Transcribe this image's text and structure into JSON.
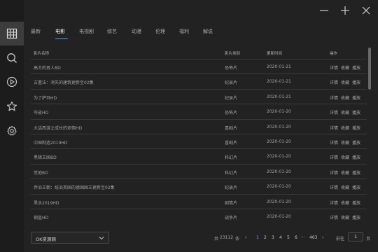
{
  "window": {
    "controls": [
      "minimize",
      "maximize",
      "close"
    ]
  },
  "sidebar": {
    "items": [
      {
        "icon": "film-grid-icon",
        "active": true
      },
      {
        "icon": "search-icon",
        "active": false
      },
      {
        "icon": "play-circle-icon",
        "active": false
      },
      {
        "icon": "star-icon",
        "active": false
      },
      {
        "icon": "gear-icon",
        "active": false
      }
    ]
  },
  "tabs": [
    {
      "label": "最新",
      "active": false
    },
    {
      "label": "电影",
      "active": true
    },
    {
      "label": "电视剧",
      "active": false
    },
    {
      "label": "综艺",
      "active": false
    },
    {
      "label": "动漫",
      "active": false
    },
    {
      "label": "伦理",
      "active": false
    },
    {
      "label": "福利",
      "active": false
    },
    {
      "label": "解说",
      "active": false
    }
  ],
  "table": {
    "headers": {
      "name": "影片名称",
      "type": "影片类别",
      "date": "更新时间",
      "actions": "操作"
    },
    "actions": {
      "detail": "详情",
      "favorite": "收藏",
      "play": "播放"
    },
    "rows": [
      {
        "name": "高大的男人BD",
        "type": "恐怖片",
        "date": "2020-01-21"
      },
      {
        "name": "古董法：消失的建筑更新至02集",
        "type": "纪录片",
        "date": "2020-01-21"
      },
      {
        "name": "为了萨玛HD",
        "type": "纪录片",
        "date": "2020-01-21"
      },
      {
        "name": "夺皮HD",
        "type": "恐怖片",
        "date": "2020-01-20"
      },
      {
        "name": "大话西游之成长的烦恼HD",
        "type": "喜剧片",
        "date": "2020-01-20"
      },
      {
        "name": "中国制造2019HD",
        "type": "喜剧片",
        "date": "2020-01-20"
      },
      {
        "name": "黑暗王国BD",
        "type": "科幻片",
        "date": "2020-01-20"
      },
      {
        "name": "荒地BD",
        "type": "科幻片",
        "date": "2020-01-20"
      },
      {
        "name": "乔治王朝：统治英国的德国国王更新至02集",
        "type": "纪录片",
        "date": "2020-01-20"
      },
      {
        "name": "黑水2019HD",
        "type": "剧情片",
        "date": "2020-01-20"
      },
      {
        "name": "钢盔HD",
        "type": "战争片",
        "date": "2020-01-20"
      }
    ]
  },
  "source_select": {
    "value": "OK资源网"
  },
  "pagination": {
    "total_prefix": "共",
    "total": "23112",
    "total_suffix": "条",
    "prev": "‹",
    "pages": [
      "1",
      "2",
      "3",
      "4",
      "5",
      "6"
    ],
    "current": "1",
    "ellipsis": "···",
    "last": "463",
    "next": "›",
    "goto_label": "前往",
    "goto_value": "1",
    "goto_suffix": "页"
  },
  "colors": {
    "background": "#222222",
    "sidebar": "#1c1c1c",
    "accent": "#5aa0ff",
    "row_border": "#3a3a3a"
  }
}
